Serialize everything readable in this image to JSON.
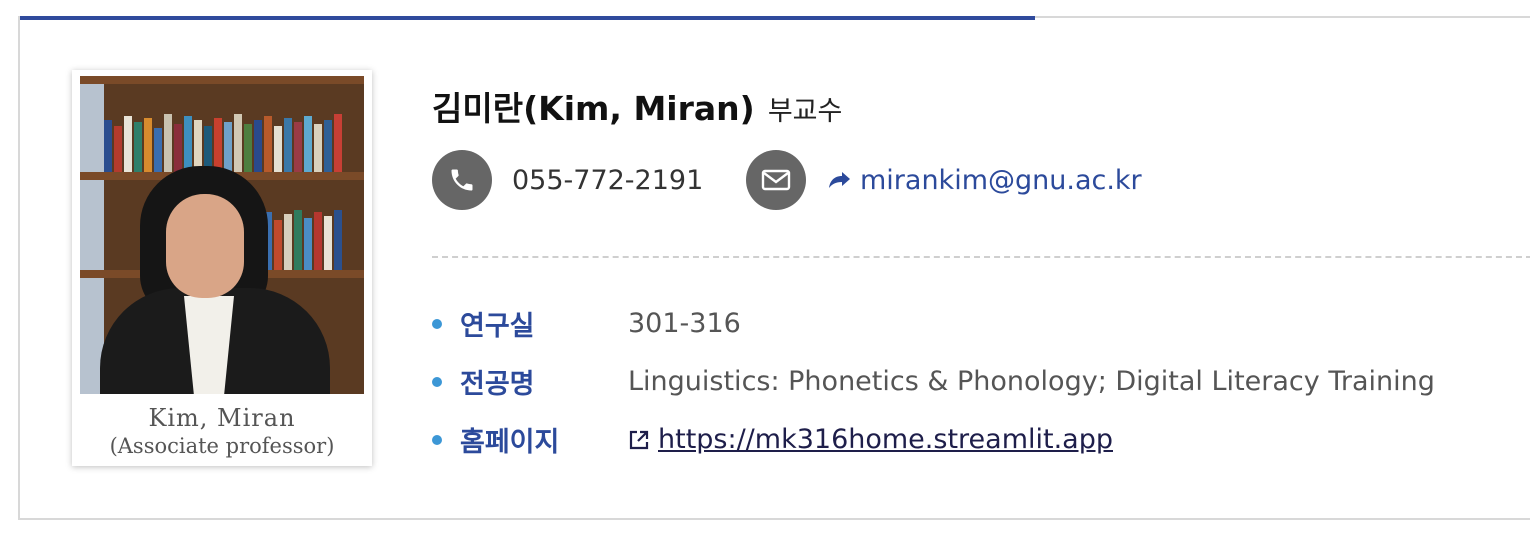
{
  "profile": {
    "name": "김미란(Kim, Miran)",
    "rank": "부교수",
    "photo_caption_name": "Kim, Miran",
    "photo_caption_title": "(Associate professor)"
  },
  "contact": {
    "phone": "055-772-2191",
    "phone_icon": "phone-icon",
    "email": "mirankim@gnu.ac.kr",
    "email_icon": "mail-icon"
  },
  "details": [
    {
      "label": "연구실",
      "value": "301-316"
    },
    {
      "label": "전공명",
      "value": "Linguistics: Phonetics & Phonology; Digital Literacy Training"
    },
    {
      "label": "홈페이지",
      "value": "https://mk316home.streamlit.app"
    }
  ],
  "colors": {
    "accent": "#2f4a9c",
    "label": "#2c4a9b",
    "bullet": "#3c97d6",
    "icon_circle": "#666666"
  }
}
